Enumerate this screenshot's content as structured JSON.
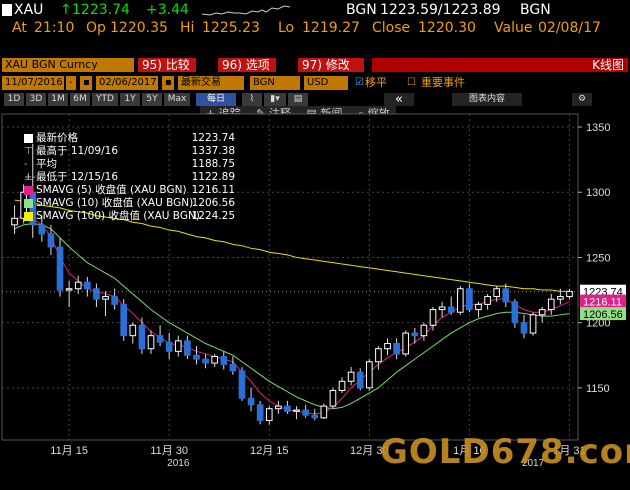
{
  "header": {
    "ticker": "XAU",
    "last_arrow": "↑",
    "last": "1223.74",
    "change": "+3.44",
    "source": "BGN",
    "bid_ask": "1223.59/1223.89",
    "source2": "BGN",
    "at_label": "At",
    "at_time": "21:10",
    "op_label": "Op",
    "op": "1220.35",
    "hi_label": "Hi",
    "hi": "1225.23",
    "lo_label": "Lo",
    "lo": "1219.27",
    "close_label": "Close",
    "close": "1220.30",
    "value_label": "Value",
    "value_date": "02/08/17"
  },
  "controls": {
    "security": "XAU BGN Curncy",
    "btn_compare": "95) 比较",
    "btn_options": "96) 选项",
    "btn_modify": "97) 修改",
    "chart_type": "K线图",
    "date_from": "11/07/2016",
    "date_to": "02/06/2017",
    "period": "最新交易",
    "source": "BGN",
    "currency": "USD",
    "chk_shift": "移平",
    "chk_events": "重要事件",
    "ranges": [
      "1D",
      "3D",
      "1M",
      "6M",
      "YTD",
      "1Y",
      "5Y",
      "Max"
    ],
    "freq": "每日",
    "btn_collapse": "«",
    "btn_edit": "图表内容"
  },
  "toolbar": {
    "track": "追踪",
    "annotate": "注释",
    "news": "新闻",
    "zoom": "缩放"
  },
  "legend": [
    {
      "label": "最新价格",
      "value": "1223.74",
      "color": "#ffffff",
      "kind": "box"
    },
    {
      "label": "最高于 11/09/16",
      "value": "1337.38",
      "color": "",
      "kind": "high"
    },
    {
      "label": "平均",
      "value": "1188.75",
      "color": "",
      "kind": "avg"
    },
    {
      "label": "最低于 12/15/16",
      "value": "1122.89",
      "color": "",
      "kind": "low"
    },
    {
      "label": "SMAVG (5) 收盘值 (XAU BGN)",
      "value": "1216.11",
      "color": "#e0208a",
      "kind": "box"
    },
    {
      "label": "SMAVG (10) 收盘值 (XAU BGN)",
      "value": "1206.56",
      "color": "#90e080",
      "kind": "box"
    },
    {
      "label": "SMAVG (100) 收盘值 (XAU BGN)",
      "value": "1224.25",
      "color": "#f0f000",
      "kind": "box"
    }
  ],
  "chart_data": {
    "type": "candlestick",
    "ylim": [
      1110,
      1360
    ],
    "y_ticks": [
      "1350",
      "1300",
      "1250",
      "1200",
      "1150"
    ],
    "y_tick_values": [
      1350,
      1300,
      1250,
      1200,
      1150
    ],
    "x_labels": [
      "11月 15",
      "11月 30",
      "12月 15",
      "12月 30",
      "1月 16",
      "1月 31"
    ],
    "x_label_index": [
      6,
      17,
      28,
      39,
      50,
      61
    ],
    "year_labels": [
      {
        "text": "2016",
        "index": 18
      },
      {
        "text": "2017",
        "index": 57
      }
    ],
    "badges": [
      {
        "text": "1223.74",
        "value": 1223.74,
        "bg": "#ffffff",
        "fg": "#000000"
      },
      {
        "text": "1216.11",
        "value": 1216.11,
        "bg": "#e0208a",
        "fg": "#ffffff"
      },
      {
        "text": "1206.56",
        "value": 1206.56,
        "bg": "#90e080",
        "fg": "#000000"
      }
    ],
    "candles": [
      [
        1275,
        1290,
        1268,
        1280
      ],
      [
        1280,
        1306,
        1276,
        1300
      ],
      [
        1300,
        1337,
        1265,
        1275
      ],
      [
        1275,
        1282,
        1262,
        1268
      ],
      [
        1268,
        1275,
        1252,
        1258
      ],
      [
        1258,
        1265,
        1220,
        1225
      ],
      [
        1225,
        1232,
        1212,
        1226
      ],
      [
        1226,
        1236,
        1222,
        1231
      ],
      [
        1231,
        1235,
        1220,
        1226
      ],
      [
        1226,
        1230,
        1212,
        1218
      ],
      [
        1218,
        1224,
        1205,
        1220
      ],
      [
        1220,
        1226,
        1210,
        1214
      ],
      [
        1214,
        1218,
        1186,
        1190
      ],
      [
        1190,
        1200,
        1184,
        1198
      ],
      [
        1198,
        1204,
        1176,
        1180
      ],
      [
        1180,
        1194,
        1176,
        1190
      ],
      [
        1190,
        1198,
        1182,
        1185
      ],
      [
        1185,
        1192,
        1172,
        1178
      ],
      [
        1178,
        1190,
        1174,
        1186
      ],
      [
        1186,
        1190,
        1172,
        1175
      ],
      [
        1175,
        1182,
        1168,
        1172
      ],
      [
        1172,
        1176,
        1165,
        1169
      ],
      [
        1169,
        1176,
        1166,
        1174
      ],
      [
        1174,
        1178,
        1164,
        1168
      ],
      [
        1168,
        1174,
        1160,
        1163
      ],
      [
        1163,
        1166,
        1140,
        1142
      ],
      [
        1142,
        1150,
        1132,
        1137
      ],
      [
        1137,
        1140,
        1122,
        1125
      ],
      [
        1125,
        1136,
        1122,
        1134
      ],
      [
        1134,
        1140,
        1130,
        1136
      ],
      [
        1136,
        1140,
        1130,
        1132
      ],
      [
        1132,
        1136,
        1126,
        1133
      ],
      [
        1133,
        1137,
        1127,
        1129
      ],
      [
        1129,
        1134,
        1125,
        1127
      ],
      [
        1127,
        1138,
        1126,
        1136
      ],
      [
        1136,
        1150,
        1134,
        1148
      ],
      [
        1148,
        1158,
        1146,
        1155
      ],
      [
        1155,
        1166,
        1152,
        1162
      ],
      [
        1162,
        1165,
        1148,
        1150
      ],
      [
        1150,
        1172,
        1148,
        1170
      ],
      [
        1170,
        1182,
        1164,
        1180
      ],
      [
        1180,
        1188,
        1175,
        1184
      ],
      [
        1184,
        1188,
        1172,
        1176
      ],
      [
        1176,
        1194,
        1174,
        1192
      ],
      [
        1192,
        1196,
        1184,
        1190
      ],
      [
        1190,
        1200,
        1186,
        1198
      ],
      [
        1198,
        1212,
        1194,
        1210
      ],
      [
        1210,
        1216,
        1204,
        1212
      ],
      [
        1212,
        1220,
        1206,
        1208
      ],
      [
        1208,
        1228,
        1206,
        1226
      ],
      [
        1226,
        1230,
        1208,
        1210
      ],
      [
        1210,
        1216,
        1204,
        1214
      ],
      [
        1214,
        1222,
        1210,
        1220
      ],
      [
        1220,
        1228,
        1216,
        1226
      ],
      [
        1226,
        1230,
        1212,
        1216
      ],
      [
        1216,
        1218,
        1196,
        1200
      ],
      [
        1200,
        1206,
        1188,
        1192
      ],
      [
        1192,
        1208,
        1190,
        1206
      ],
      [
        1206,
        1212,
        1200,
        1210
      ],
      [
        1210,
        1222,
        1206,
        1218
      ],
      [
        1218,
        1226,
        1214,
        1220
      ],
      [
        1220,
        1226,
        1218,
        1224
      ]
    ],
    "sma5": [
      1278,
      1283,
      1280,
      1275,
      1266,
      1250,
      1238,
      1232,
      1226,
      1224,
      1222,
      1220,
      1213,
      1207,
      1200,
      1193,
      1189,
      1184,
      1183,
      1181,
      1178,
      1176,
      1174,
      1172,
      1170,
      1162,
      1155,
      1146,
      1140,
      1136,
      1133,
      1132,
      1131,
      1130,
      1131,
      1135,
      1142,
      1150,
      1156,
      1162,
      1168,
      1173,
      1177,
      1181,
      1185,
      1190,
      1198,
      1204,
      1208,
      1212,
      1214,
      1214,
      1216,
      1218,
      1218,
      1214,
      1210,
      1208,
      1208,
      1210,
      1213,
      1216
    ],
    "sma10": [
      1272,
      1275,
      1276,
      1275,
      1272,
      1265,
      1258,
      1252,
      1246,
      1242,
      1238,
      1234,
      1228,
      1222,
      1216,
      1210,
      1205,
      1200,
      1196,
      1192,
      1188,
      1184,
      1181,
      1178,
      1175,
      1170,
      1165,
      1160,
      1155,
      1151,
      1147,
      1143,
      1140,
      1137,
      1135,
      1134,
      1135,
      1138,
      1142,
      1146,
      1150,
      1156,
      1162,
      1167,
      1172,
      1177,
      1182,
      1187,
      1192,
      1196,
      1200,
      1203,
      1205,
      1207,
      1208,
      1208,
      1207,
      1206,
      1205,
      1205,
      1206,
      1207
    ],
    "sma100": [
      1294,
      1293,
      1292,
      1290,
      1289,
      1288,
      1286,
      1285,
      1284,
      1282,
      1281,
      1280,
      1279,
      1277,
      1276,
      1274,
      1273,
      1271,
      1270,
      1268,
      1266,
      1265,
      1263,
      1262,
      1260,
      1259,
      1257,
      1256,
      1254,
      1253,
      1252,
      1250,
      1249,
      1248,
      1247,
      1246,
      1245,
      1244,
      1243,
      1242,
      1241,
      1240,
      1239,
      1238,
      1237,
      1236,
      1235,
      1234,
      1233,
      1232,
      1231,
      1230,
      1229,
      1228,
      1228,
      1227,
      1226,
      1226,
      1225,
      1225,
      1224,
      1224
    ]
  },
  "watermark": "GOLD678.com"
}
